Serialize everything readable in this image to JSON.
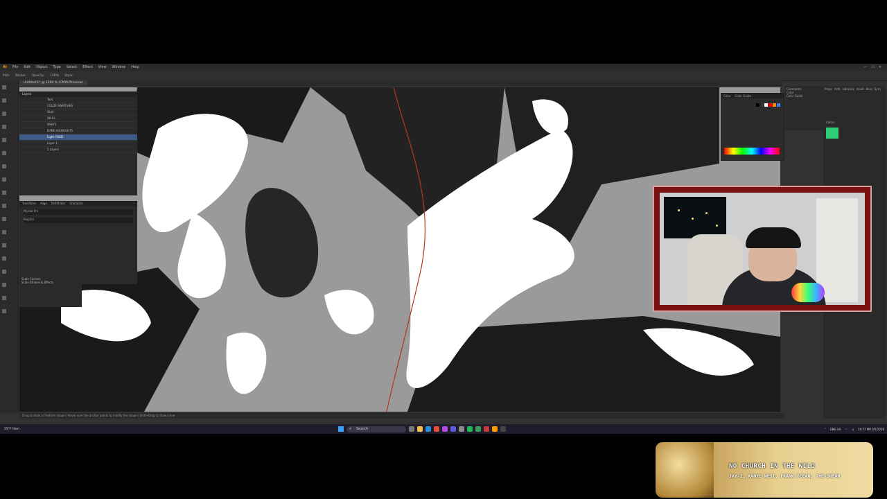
{
  "app": {
    "logo": "Ai",
    "menu": [
      "File",
      "Edit",
      "Object",
      "Type",
      "Select",
      "Effect",
      "View",
      "Window",
      "Help"
    ],
    "document_tab": "Untitled-1* @ 1200 % (CMYK/Preview)",
    "control_bar": [
      "Path",
      "Stroke:",
      "Opacity:",
      "100%",
      "Style:"
    ]
  },
  "layers_panel": {
    "title": "Layers",
    "rows": [
      "Text",
      "COLOR SWATCHES",
      "Skull",
      "SKULL",
      "WHITE",
      "DARK HIGHLIGHTS",
      "Light FIXED",
      "Layer 1"
    ],
    "selected_index": 6,
    "footer": "5 Layers"
  },
  "properties_panel": {
    "tabs": [
      "Transform",
      "Align",
      "Pathfinder"
    ],
    "character_tab": "Character",
    "font": "Myriad Pro",
    "style": "Regular",
    "checkboxes": [
      "Scale Corners",
      "Scale Strokes & Effects"
    ]
  },
  "color_panel": {
    "tabs": [
      "Color",
      "Color Guide"
    ],
    "swatch_colors": [
      "#000000",
      "#333333",
      "#ffffff",
      "#ff0000",
      "#ff8c00",
      "#3a7bff"
    ]
  },
  "comments_panel": {
    "items": [
      "Comments",
      "Color",
      "Color Guide"
    ]
  },
  "libraries_panel": {
    "tabs": [
      "Props",
      "Artb",
      "Libraries",
      "Asset",
      "Brus",
      "Sym"
    ],
    "section": "Colors",
    "color": "#2fcf7a"
  },
  "status_bar": {
    "text": "Drag to draw a freeform shape | Hover over the anchor points to modify the shape | Shift+Drag to draw a line"
  },
  "taskbar": {
    "weather_temp": "55°F",
    "weather_desc": "Rain",
    "search_placeholder": "Search",
    "lang_top": "ENG",
    "lang_bottom": "US",
    "time": "10:57 PM",
    "date": "3/5/2026"
  },
  "now_playing": {
    "title": "NO CHURCH IN THE WILD",
    "artist": "JAY-Z, KANYE WEST, FRANK OCEAN, THE-DREAM"
  }
}
